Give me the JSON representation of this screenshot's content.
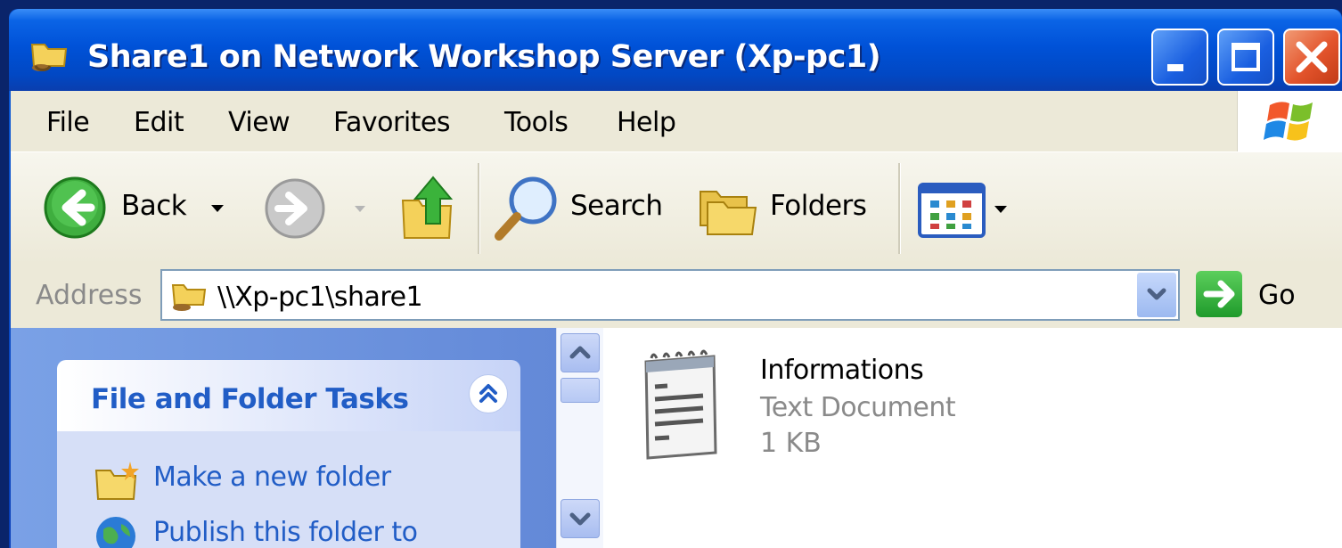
{
  "window": {
    "title": "Share1 on Network Workshop Server (Xp-pc1)",
    "icon": "network-share-folder-icon",
    "controls": [
      "minimize-icon",
      "maximize-icon",
      "close-icon"
    ]
  },
  "menu": {
    "items": [
      "File",
      "Edit",
      "View",
      "Favorites",
      "Tools",
      "Help"
    ]
  },
  "toolbar": {
    "back_label": "Back",
    "search_label": "Search",
    "folders_label": "Folders",
    "icons": [
      "back-arrow-icon",
      "forward-arrow-icon",
      "up-folder-icon",
      "search-magnifier-icon",
      "folders-icon",
      "views-icon"
    ]
  },
  "address": {
    "label": "Address",
    "value": "\\\\Xp-pc1\\share1",
    "go_label": "Go"
  },
  "taskpane": {
    "title": "File and Folder Tasks",
    "links": [
      "Make a new folder",
      "Publish this folder to"
    ]
  },
  "files": [
    {
      "name": "Informations",
      "type": "Text Document",
      "size": "1 KB",
      "icon": "text-document-icon"
    }
  ],
  "colors": {
    "titlebar": "#0052d8",
    "chrome": "#ece9d8",
    "taskpane": "#6f95de",
    "task_link": "#215dc6",
    "close_button": "#e3542c"
  }
}
